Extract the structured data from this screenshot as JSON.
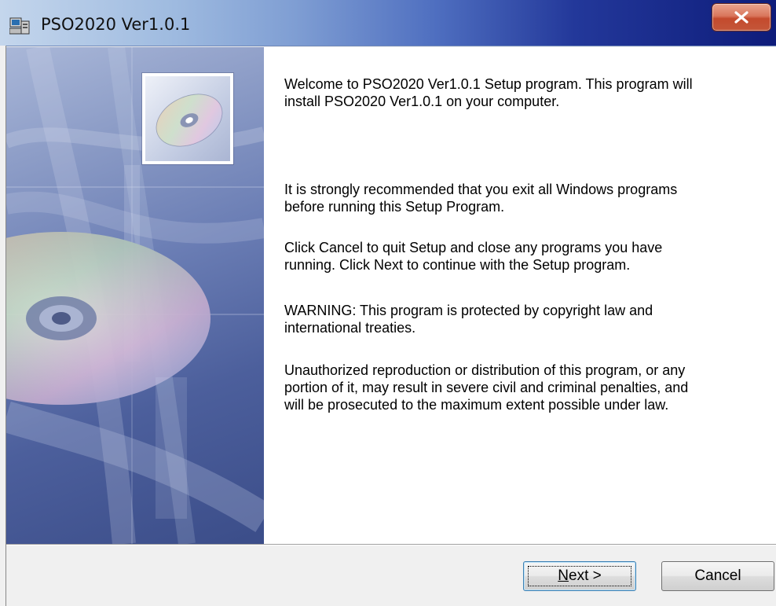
{
  "window": {
    "title": "PSO2020 Ver1.0.1",
    "close_glyph": "x",
    "icon": "setup-computer-icon",
    "close_icon": "close-icon"
  },
  "side_panel": {
    "image": "cd-disc-artwork"
  },
  "body": {
    "paragraphs": [
      "Welcome to PSO2020 Ver1.0.1 Setup program. This program will\ninstall PSO2020 Ver1.0.1 on your computer.",
      "It is strongly recommended that you exit all Windows programs\nbefore running this Setup Program.",
      "Click Cancel to quit Setup and close any programs you have\nrunning.  Click Next to continue with the Setup program.",
      "WARNING: This program is protected by copyright law and\ninternational treaties.",
      "Unauthorized reproduction or distribution of this program, or any\nportion of it, may result in severe civil and criminal penalties, and\nwill be prosecuted to the maximum extent possible under law."
    ]
  },
  "buttons": {
    "next_mnemonic": "N",
    "next_rest": "ext >",
    "cancel": "Cancel"
  },
  "colors": {
    "title_gradient_start": "#c4d6ec",
    "title_gradient_end": "#0e1c7a",
    "close_red": "#c44a2d",
    "panel_blue": "#4c5f9c"
  }
}
